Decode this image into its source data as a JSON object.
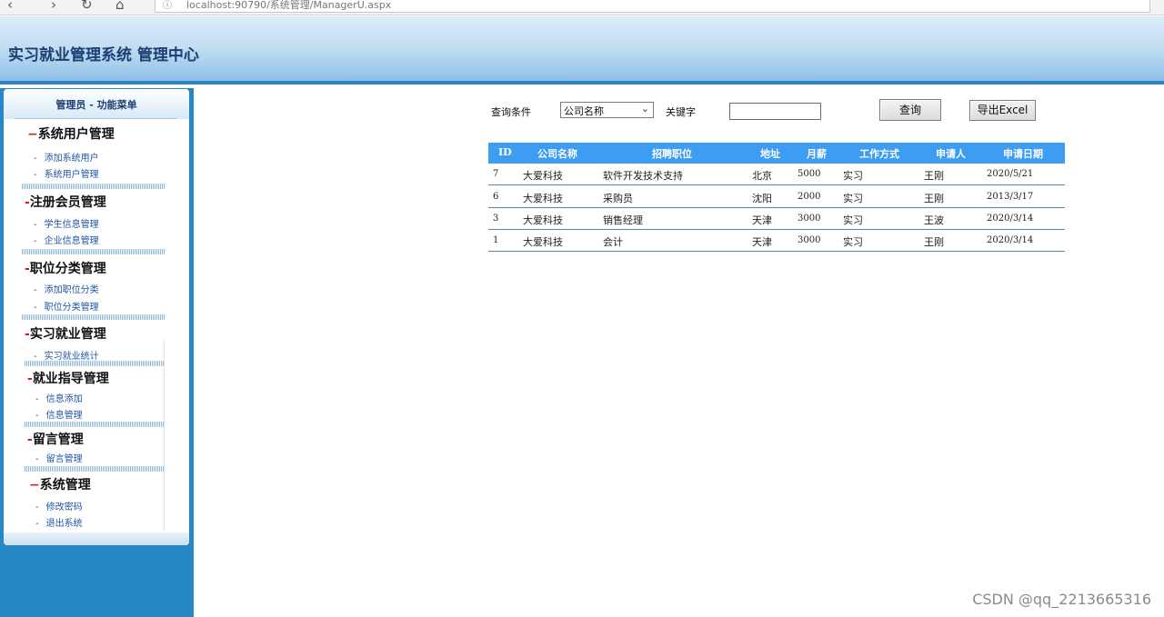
{
  "browser": {
    "url": "localhost:90790/系统管理/ManagerU.aspx"
  },
  "header": {
    "title": "实习就业管理系统 管理中心"
  },
  "sidebar": {
    "heading": "管理员 - 功能菜单",
    "sections": [
      {
        "title": "系统用户管理",
        "items": [
          "添加系统用户",
          "系统用户管理"
        ]
      },
      {
        "title": "注册会员管理",
        "items": [
          "学生信息管理",
          "企业信息管理"
        ]
      },
      {
        "title": "职位分类管理",
        "items": [
          "添加职位分类",
          "职位分类管理"
        ]
      },
      {
        "title": "实习就业管理",
        "items": [
          "实习就业统计"
        ]
      },
      {
        "title": "就业指导管理",
        "items": [
          "信息添加",
          "信息管理"
        ]
      },
      {
        "title": "留言管理",
        "items": [
          "留言管理"
        ]
      },
      {
        "title": "系统管理",
        "items": [
          "修改密码",
          "退出系统"
        ]
      }
    ]
  },
  "search": {
    "condition_label": "查询条件",
    "condition_value": "公司名称",
    "keyword_label": "关键字",
    "keyword_value": "",
    "query_button": "查询",
    "export_button": "导出Excel"
  },
  "table": {
    "columns": [
      "ID",
      "公司名称",
      "招聘职位",
      "地址",
      "月薪",
      "工作方式",
      "申请人",
      "申请日期"
    ],
    "rows": [
      [
        "7",
        "大爱科技",
        "软件开发技术支持",
        "北京",
        "5000",
        "实习",
        "王刚",
        "2020/5/21"
      ],
      [
        "6",
        "大爱科技",
        "采购员",
        "沈阳",
        "2000",
        "实习",
        "王刚",
        "2013/3/17"
      ],
      [
        "3",
        "大爱科技",
        "销售经理",
        "天津",
        "3000",
        "实习",
        "王波",
        "2020/3/14"
      ],
      [
        "1",
        "大爱科技",
        "会计",
        "天津",
        "3000",
        "实习",
        "王刚",
        "2020/3/14"
      ]
    ]
  },
  "watermark": "CSDN @qq_2213665316",
  "colors": {
    "header_accent": "#2a86c4",
    "table_header": "#3d9df0",
    "sidebar_bg": "#2688c6",
    "section_dash": "#d42020"
  }
}
